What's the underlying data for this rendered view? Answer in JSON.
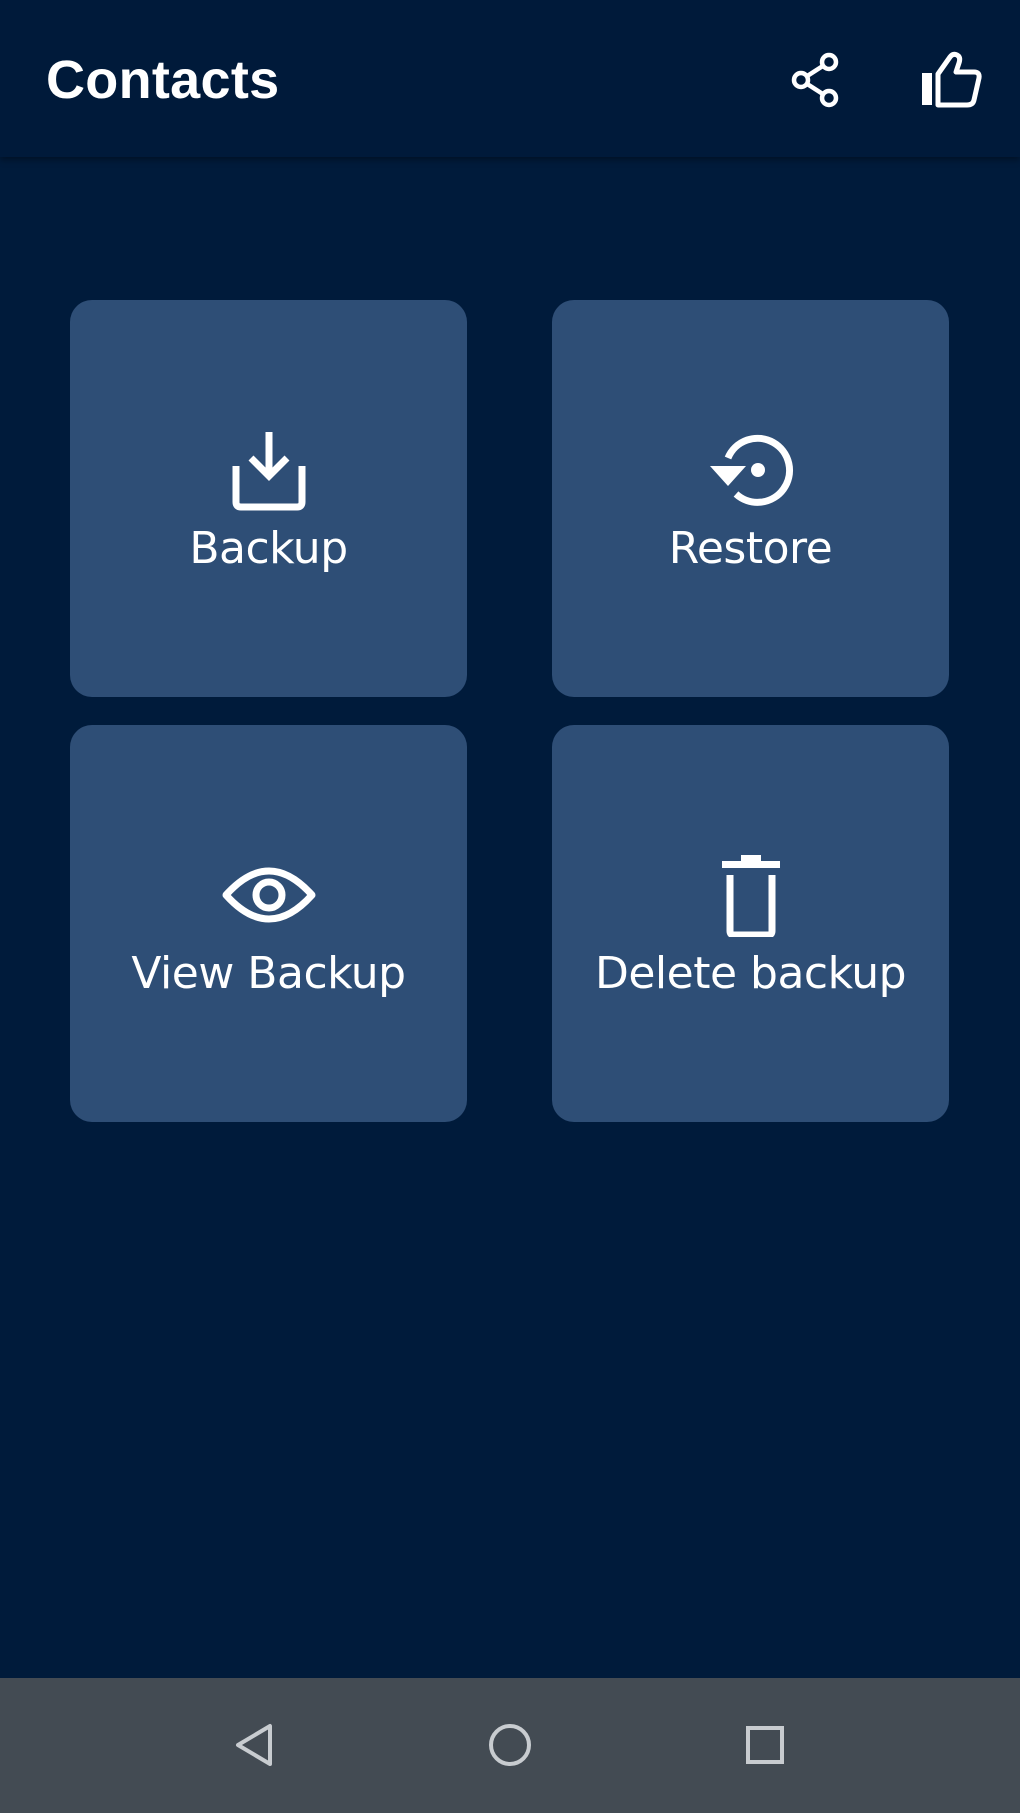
{
  "app_bar": {
    "title": "Contacts",
    "actions": [
      {
        "name": "share",
        "icon": "share-icon"
      },
      {
        "name": "like",
        "icon": "thumbs-up-icon"
      }
    ]
  },
  "tiles": [
    {
      "label": "Backup",
      "icon": "download-tray-icon"
    },
    {
      "label": "Restore",
      "icon": "restore-history-icon"
    },
    {
      "label": "View Backup",
      "icon": "eye-icon"
    },
    {
      "label": "Delete backup",
      "icon": "trash-icon"
    }
  ],
  "nav_bar": {
    "buttons": [
      {
        "name": "back",
        "icon": "back-triangle-icon"
      },
      {
        "name": "home",
        "icon": "home-circle-icon"
      },
      {
        "name": "recents",
        "icon": "recents-square-icon"
      }
    ]
  },
  "colors": {
    "background": "#001B3B",
    "app_bar": "#001A3A",
    "tile": "#2E4E76",
    "nav_bar": "#434B53",
    "foreground": "#FFFFFF"
  }
}
